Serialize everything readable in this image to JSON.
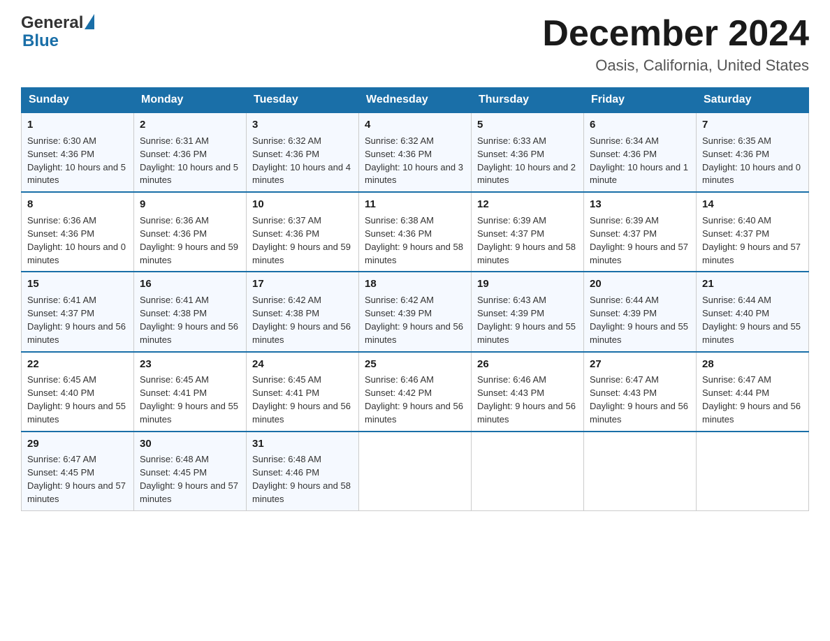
{
  "logo": {
    "general": "General",
    "blue": "Blue"
  },
  "title": {
    "month_year": "December 2024",
    "location": "Oasis, California, United States"
  },
  "headers": [
    "Sunday",
    "Monday",
    "Tuesday",
    "Wednesday",
    "Thursday",
    "Friday",
    "Saturday"
  ],
  "weeks": [
    [
      {
        "day": "1",
        "sunrise": "6:30 AM",
        "sunset": "4:36 PM",
        "daylight": "10 hours and 5 minutes."
      },
      {
        "day": "2",
        "sunrise": "6:31 AM",
        "sunset": "4:36 PM",
        "daylight": "10 hours and 5 minutes."
      },
      {
        "day": "3",
        "sunrise": "6:32 AM",
        "sunset": "4:36 PM",
        "daylight": "10 hours and 4 minutes."
      },
      {
        "day": "4",
        "sunrise": "6:32 AM",
        "sunset": "4:36 PM",
        "daylight": "10 hours and 3 minutes."
      },
      {
        "day": "5",
        "sunrise": "6:33 AM",
        "sunset": "4:36 PM",
        "daylight": "10 hours and 2 minutes."
      },
      {
        "day": "6",
        "sunrise": "6:34 AM",
        "sunset": "4:36 PM",
        "daylight": "10 hours and 1 minute."
      },
      {
        "day": "7",
        "sunrise": "6:35 AM",
        "sunset": "4:36 PM",
        "daylight": "10 hours and 0 minutes."
      }
    ],
    [
      {
        "day": "8",
        "sunrise": "6:36 AM",
        "sunset": "4:36 PM",
        "daylight": "10 hours and 0 minutes."
      },
      {
        "day": "9",
        "sunrise": "6:36 AM",
        "sunset": "4:36 PM",
        "daylight": "9 hours and 59 minutes."
      },
      {
        "day": "10",
        "sunrise": "6:37 AM",
        "sunset": "4:36 PM",
        "daylight": "9 hours and 59 minutes."
      },
      {
        "day": "11",
        "sunrise": "6:38 AM",
        "sunset": "4:36 PM",
        "daylight": "9 hours and 58 minutes."
      },
      {
        "day": "12",
        "sunrise": "6:39 AM",
        "sunset": "4:37 PM",
        "daylight": "9 hours and 58 minutes."
      },
      {
        "day": "13",
        "sunrise": "6:39 AM",
        "sunset": "4:37 PM",
        "daylight": "9 hours and 57 minutes."
      },
      {
        "day": "14",
        "sunrise": "6:40 AM",
        "sunset": "4:37 PM",
        "daylight": "9 hours and 57 minutes."
      }
    ],
    [
      {
        "day": "15",
        "sunrise": "6:41 AM",
        "sunset": "4:37 PM",
        "daylight": "9 hours and 56 minutes."
      },
      {
        "day": "16",
        "sunrise": "6:41 AM",
        "sunset": "4:38 PM",
        "daylight": "9 hours and 56 minutes."
      },
      {
        "day": "17",
        "sunrise": "6:42 AM",
        "sunset": "4:38 PM",
        "daylight": "9 hours and 56 minutes."
      },
      {
        "day": "18",
        "sunrise": "6:42 AM",
        "sunset": "4:39 PM",
        "daylight": "9 hours and 56 minutes."
      },
      {
        "day": "19",
        "sunrise": "6:43 AM",
        "sunset": "4:39 PM",
        "daylight": "9 hours and 55 minutes."
      },
      {
        "day": "20",
        "sunrise": "6:44 AM",
        "sunset": "4:39 PM",
        "daylight": "9 hours and 55 minutes."
      },
      {
        "day": "21",
        "sunrise": "6:44 AM",
        "sunset": "4:40 PM",
        "daylight": "9 hours and 55 minutes."
      }
    ],
    [
      {
        "day": "22",
        "sunrise": "6:45 AM",
        "sunset": "4:40 PM",
        "daylight": "9 hours and 55 minutes."
      },
      {
        "day": "23",
        "sunrise": "6:45 AM",
        "sunset": "4:41 PM",
        "daylight": "9 hours and 55 minutes."
      },
      {
        "day": "24",
        "sunrise": "6:45 AM",
        "sunset": "4:41 PM",
        "daylight": "9 hours and 56 minutes."
      },
      {
        "day": "25",
        "sunrise": "6:46 AM",
        "sunset": "4:42 PM",
        "daylight": "9 hours and 56 minutes."
      },
      {
        "day": "26",
        "sunrise": "6:46 AM",
        "sunset": "4:43 PM",
        "daylight": "9 hours and 56 minutes."
      },
      {
        "day": "27",
        "sunrise": "6:47 AM",
        "sunset": "4:43 PM",
        "daylight": "9 hours and 56 minutes."
      },
      {
        "day": "28",
        "sunrise": "6:47 AM",
        "sunset": "4:44 PM",
        "daylight": "9 hours and 56 minutes."
      }
    ],
    [
      {
        "day": "29",
        "sunrise": "6:47 AM",
        "sunset": "4:45 PM",
        "daylight": "9 hours and 57 minutes."
      },
      {
        "day": "30",
        "sunrise": "6:48 AM",
        "sunset": "4:45 PM",
        "daylight": "9 hours and 57 minutes."
      },
      {
        "day": "31",
        "sunrise": "6:48 AM",
        "sunset": "4:46 PM",
        "daylight": "9 hours and 58 minutes."
      },
      null,
      null,
      null,
      null
    ]
  ],
  "labels": {
    "sunrise": "Sunrise:",
    "sunset": "Sunset:",
    "daylight": "Daylight:"
  }
}
